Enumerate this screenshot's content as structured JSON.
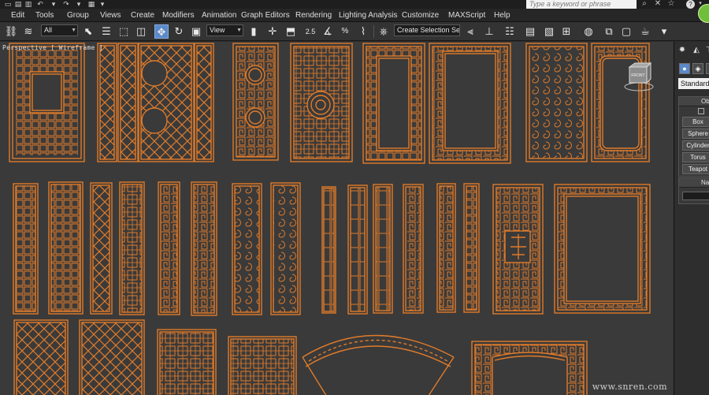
{
  "quick_access": [
    "file-new-icon",
    "file-open-icon",
    "file-save-icon",
    "undo-icon",
    "redo-icon",
    "project-folder-icon"
  ],
  "search": {
    "placeholder": "Type a keyword or phrase"
  },
  "title_icons": [
    "binoculars-icon",
    "communication-icon",
    "star-icon",
    "help-icon"
  ],
  "help_glyph": "?",
  "menu": {
    "items": [
      "Edit",
      "Tools",
      "Group",
      "Views",
      "Create",
      "Modifiers",
      "Animation",
      "Graph Editors",
      "Rendering",
      "Lighting Analysis",
      "Customize",
      "MAXScript",
      "Help"
    ]
  },
  "toolbar": {
    "filter_value": "All",
    "refcoord_value": "View",
    "selection_set_value": "Create Selection Se",
    "snap_label": "2.5",
    "percent_label": "%"
  },
  "viewport": {
    "label": "Perspective [ Wireframe ]",
    "viewcube_label": "FRONT",
    "watermark": "www.snren.com",
    "line_color": "#e07b2a",
    "background": "#3a3a3a"
  },
  "command_panel": {
    "tabs": [
      "create-icon",
      "modify-icon",
      "hierarchy-icon"
    ],
    "category_dropdown": "Standard Pr",
    "object_type_header": "Ob",
    "primitives": [
      "Box",
      "Sphere",
      "Cylinder",
      "Torus",
      "Teapot"
    ],
    "name_color_header": "Na"
  }
}
